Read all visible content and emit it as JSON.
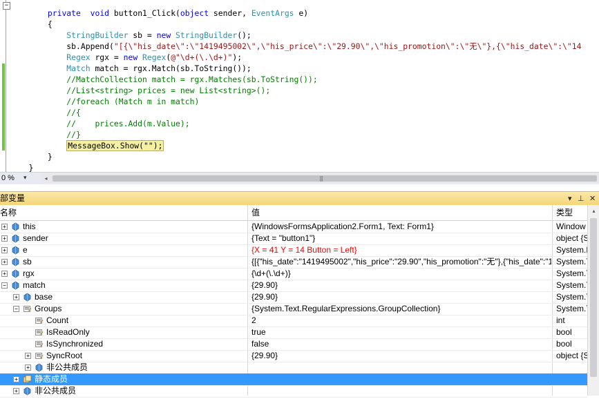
{
  "editor": {
    "lines": [
      {
        "indent": "        ",
        "tokens": [
          [
            "kw",
            "private"
          ],
          [
            "",
            "  "
          ],
          [
            "kw",
            "void"
          ],
          [
            "",
            " button1_Click("
          ],
          [
            "kw",
            "object"
          ],
          [
            "",
            " sender, "
          ],
          [
            "ty",
            "EventArgs"
          ],
          [
            "",
            " e)"
          ]
        ]
      },
      {
        "indent": "        ",
        "tokens": [
          [
            "",
            "{"
          ]
        ]
      },
      {
        "indent": "            ",
        "tokens": [
          [
            "ty",
            "StringBuilder"
          ],
          [
            "",
            " sb = "
          ],
          [
            "kw",
            "new"
          ],
          [
            "",
            " "
          ],
          [
            "ty",
            "StringBuilder"
          ],
          [
            "",
            "();"
          ]
        ]
      },
      {
        "indent": "            ",
        "tokens": [
          [
            "",
            "sb.Append("
          ],
          [
            "st",
            "\"[{\\\"his_date\\\":\\\"1419495002\\\",\\\"his_price\\\":\\\"29.90\\\",\\\"his_promotion\\\":\\\"无\\\"},{\\\"his_date\\\":\\\"14"
          ]
        ]
      },
      {
        "indent": "            ",
        "tokens": [
          [
            "ty",
            "Regex"
          ],
          [
            "",
            " rgx = "
          ],
          [
            "kw",
            "new"
          ],
          [
            "",
            " "
          ],
          [
            "ty",
            "Regex"
          ],
          [
            "",
            "("
          ],
          [
            "st",
            "@\"\\d+(\\.\\d+)\""
          ],
          [
            "",
            ");"
          ]
        ]
      },
      {
        "indent": "            ",
        "tokens": [
          [
            "ty",
            "Match"
          ],
          [
            "",
            " match = rgx.Match(sb.ToString());"
          ]
        ]
      },
      {
        "indent": "            ",
        "tokens": [
          [
            "cm",
            "//MatchCollection match = rgx.Matches(sb.ToString());"
          ]
        ]
      },
      {
        "indent": "            ",
        "tokens": [
          [
            "cm",
            "//List<string> prices = new List<string>();"
          ]
        ]
      },
      {
        "indent": "            ",
        "tokens": [
          [
            "cm",
            "//foreach (Match m in match)"
          ]
        ]
      },
      {
        "indent": "            ",
        "tokens": [
          [
            "cm",
            "//{"
          ]
        ]
      },
      {
        "indent": "            ",
        "tokens": [
          [
            "cm",
            "//    prices.Add(m.Value);"
          ]
        ]
      },
      {
        "indent": "            ",
        "tokens": [
          [
            "cm",
            "//}"
          ]
        ]
      },
      {
        "indent": "            ",
        "tokens": [
          [
            "hl",
            "MessageBox.Show(\"\");"
          ]
        ]
      },
      {
        "indent": "        ",
        "tokens": [
          [
            "",
            "}"
          ]
        ]
      },
      {
        "indent": "    ",
        "tokens": [
          [
            "",
            "}"
          ]
        ]
      }
    ],
    "zoom": "0 %"
  },
  "locals": {
    "title": "部变量",
    "pin_icon": "pin-icon",
    "close_icon": "close-icon",
    "columns": {
      "name": "名称",
      "value": "值",
      "type": "类型"
    },
    "rows": [
      {
        "name": "this",
        "value": "{WindowsFormsApplication2.Form1, Text: Form1}",
        "type": "Window",
        "level": 0,
        "expander": "+",
        "icon": "field-icon",
        "changed": false,
        "selected": false
      },
      {
        "name": "sender",
        "value": "{Text = \"button1\"}",
        "type": "object {S",
        "level": 0,
        "expander": "+",
        "icon": "field-icon",
        "changed": false,
        "selected": false
      },
      {
        "name": "e",
        "value": "{X = 41 Y = 14 Button = Left}",
        "type": "System.E",
        "level": 0,
        "expander": "+",
        "icon": "field-icon",
        "changed": true,
        "selected": false
      },
      {
        "name": "sb",
        "value": "{[{\"his_date\":\"1419495002\",\"his_price\":\"29.90\",\"his_promotion\":\"无\"},{\"his_date\":\"14",
        "type": "System.T",
        "level": 0,
        "expander": "+",
        "icon": "field-icon",
        "changed": false,
        "selected": false
      },
      {
        "name": "rgx",
        "value": "{\\d+(\\.\\d+)}",
        "type": "System.T",
        "level": 0,
        "expander": "+",
        "icon": "field-icon",
        "changed": false,
        "selected": false
      },
      {
        "name": "match",
        "value": "{29.90}",
        "type": "System.T",
        "level": 0,
        "expander": "−",
        "icon": "field-icon",
        "changed": false,
        "selected": false
      },
      {
        "name": "base",
        "value": "{29.90}",
        "type": "System.T",
        "level": 1,
        "expander": "+",
        "icon": "field-icon",
        "changed": false,
        "selected": false
      },
      {
        "name": "Groups",
        "value": "{System.Text.RegularExpressions.GroupCollection}",
        "type": "System.T",
        "level": 1,
        "expander": "−",
        "icon": "property-icon",
        "changed": false,
        "selected": false
      },
      {
        "name": "Count",
        "value": "2",
        "type": "int",
        "level": 2,
        "expander": "",
        "icon": "property-icon",
        "changed": false,
        "selected": false
      },
      {
        "name": "IsReadOnly",
        "value": "true",
        "type": "bool",
        "level": 2,
        "expander": "",
        "icon": "property-icon",
        "changed": false,
        "selected": false
      },
      {
        "name": "IsSynchronized",
        "value": "false",
        "type": "bool",
        "level": 2,
        "expander": "",
        "icon": "property-icon",
        "changed": false,
        "selected": false
      },
      {
        "name": "SyncRoot",
        "value": "{29.90}",
        "type": "object {S",
        "level": 2,
        "expander": "+",
        "icon": "property-icon",
        "changed": false,
        "selected": false
      },
      {
        "name": "非公共成员",
        "value": "",
        "type": "",
        "level": 2,
        "expander": "+",
        "icon": "field-icon",
        "changed": false,
        "selected": false
      },
      {
        "name": "静态成员",
        "value": "",
        "type": "",
        "level": 1,
        "expander": "+",
        "icon": "static-members-icon",
        "changed": false,
        "selected": true
      },
      {
        "name": "非公共成员",
        "value": "",
        "type": "",
        "level": 1,
        "expander": "+",
        "icon": "field-icon",
        "changed": false,
        "selected": false
      }
    ]
  },
  "colors": {
    "keyword": "#0000ff",
    "type": "#2b91af",
    "comment": "#008000",
    "string": "#a31515",
    "selection": "#3399ff",
    "changed_value": "#ff0000",
    "pane_title": "#f5d67a"
  }
}
